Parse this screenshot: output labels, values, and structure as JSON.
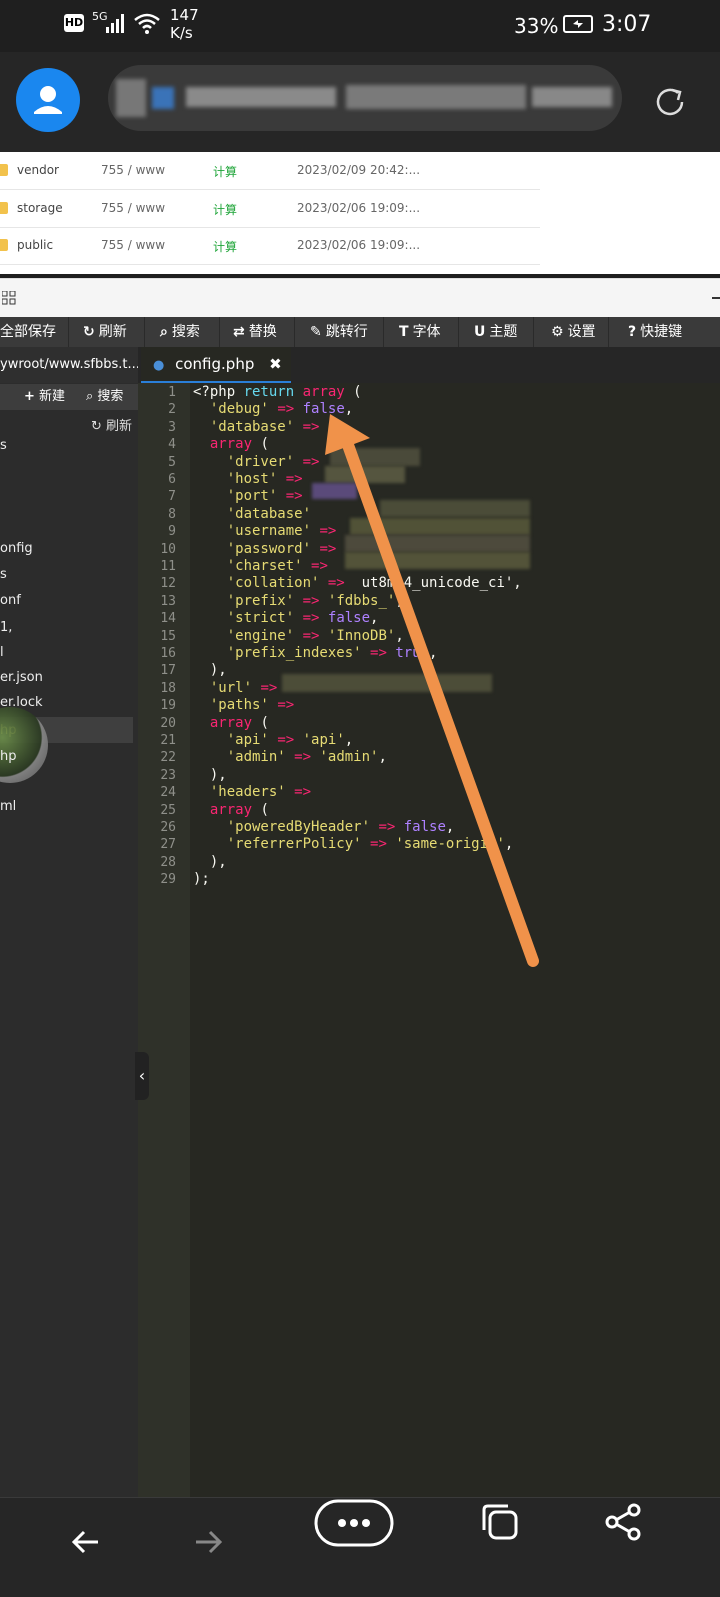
{
  "status_bar": {
    "hd": "HD",
    "signal": "5G",
    "speed": "147\nK/s",
    "speed_line1": "147",
    "speed_line2": "K/s",
    "battery": "33%",
    "time": "3:07"
  },
  "files": [
    {
      "name": "vendor",
      "perm": "755 / www",
      "calc": "计算",
      "date": "2023/02/09 20:42:..."
    },
    {
      "name": "storage",
      "perm": "755 / www",
      "calc": "计算",
      "date": "2023/02/06 19:09:..."
    },
    {
      "name": "public",
      "perm": "755 / www",
      "calc": "计算",
      "date": "2023/02/06 19:09:..."
    }
  ],
  "toolbar": {
    "save_all": "全部保存",
    "refresh": "刷新",
    "search": "搜索",
    "replace": "替换",
    "goto_line": "跳转行",
    "font": "字体",
    "theme": "主题",
    "settings": "设置",
    "shortcuts": "快捷键"
  },
  "sidebar": {
    "path": "ywroot/www.sfbbs.t...",
    "new": "新建",
    "search": "搜索",
    "refresh": "刷新",
    "items": [
      "s",
      "onfig",
      "s",
      "onf",
      "1,",
      "l",
      "er.json",
      "er.lock",
      "hp",
      "hp",
      "ml"
    ]
  },
  "tab": {
    "filename": "config.php"
  },
  "code_lines": [
    "<?php return array (",
    "  'debug' => false,",
    "  'database' =>",
    "  array (",
    "    'driver' =>",
    "    'host' =>",
    "    'port' =>",
    "    'database'",
    "    'username' =>",
    "    'password' =>",
    "    'charset' =>",
    "    'collation' =>  ut8mb4_unicode_ci',",
    "    'prefix' => 'fdbbs_',",
    "    'strict' => false,",
    "    'engine' => 'InnoDB',",
    "    'prefix_indexes' => true,",
    "  ),",
    "  'url' =>",
    "  'paths' =>",
    "  array (",
    "    'api' => 'api',",
    "    'admin' => 'admin',",
    "  ),",
    "  'headers' =>",
    "  array (",
    "    'poweredByHeader' => false,",
    "    'referrerPolicy' => 'same-origin',",
    "  ),",
    ");"
  ],
  "colors": {
    "accent": "#1a87ef",
    "arrow": "#f0924a",
    "editor_bg": "#272822",
    "calc_green": "#20a53a"
  }
}
